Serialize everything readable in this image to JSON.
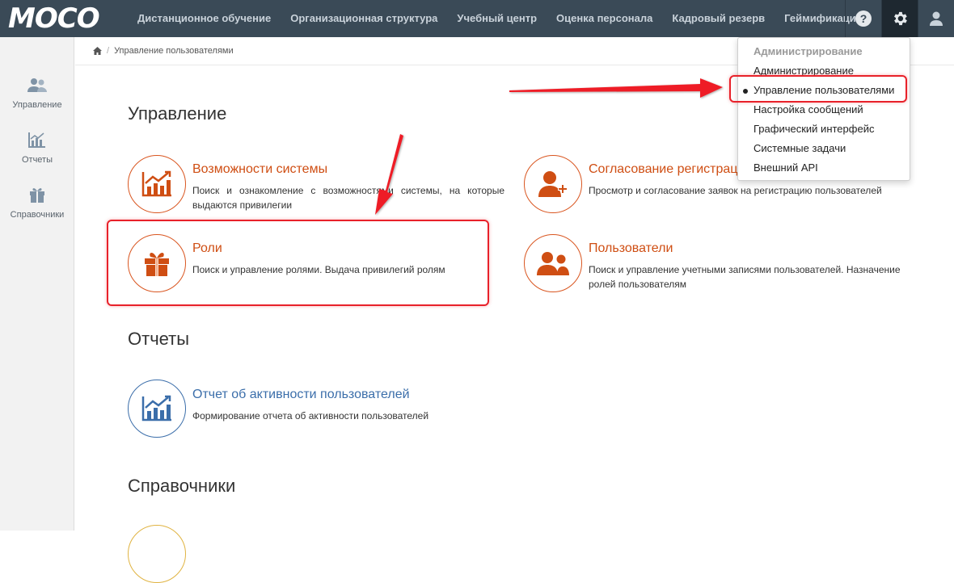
{
  "brand": {
    "logo_text": "MOCO"
  },
  "topnav": {
    "items": [
      "Дистанционное обучение",
      "Организационная структура",
      "Учебный центр",
      "Оценка персонала",
      "Кадровый резерв",
      "Геймификация"
    ],
    "icons": [
      "help-icon",
      "gear-icon",
      "user-icon"
    ],
    "help_glyph": "?"
  },
  "sidebar": {
    "items": [
      {
        "label": "Управление",
        "icon": "users-icon"
      },
      {
        "label": "Отчеты",
        "icon": "chart-icon"
      },
      {
        "label": "Справочники",
        "icon": "gift-icon"
      }
    ]
  },
  "breadcrumb": {
    "home_icon": "home-icon",
    "sep": "/",
    "current": "Управление пользователями"
  },
  "sections": {
    "management": {
      "title": "Управление",
      "cards": [
        {
          "title": "Возможности системы",
          "desc": "Поиск и ознакомление с возможностями системы, на которые выдаются привилегии",
          "icon": "chart-icon"
        },
        {
          "title": "Согласование регистраций",
          "desc": "Просмотр и согласование заявок на регистрацию пользователей",
          "icon": "user-add-icon"
        },
        {
          "title": "Роли",
          "desc": "Поиск и управление ролями. Выдача привилегий ролям",
          "icon": "gift-icon"
        },
        {
          "title": "Пользователи",
          "desc": "Поиск и управление учетными записями пользователей. Назначение ролей пользователям",
          "icon": "users-icon"
        }
      ]
    },
    "reports": {
      "title": "Отчеты",
      "cards": [
        {
          "title": "Отчет об активности пользователей",
          "desc": "Формирование отчета об активности пользователей",
          "icon": "chart-icon"
        }
      ]
    },
    "references": {
      "title": "Справочники"
    }
  },
  "dropdown": {
    "header": "Администрирование",
    "items": [
      "Администрирование",
      "Управление пользователями",
      "Настройка сообщений",
      "Графический интерфейс",
      "Системные задачи",
      "Внешний API"
    ],
    "current": "Управление пользователями"
  },
  "colors": {
    "navbar": "#3a4a57",
    "accent": "#cf4e13",
    "link_blue": "#3b6eaa",
    "highlight_red": "#e8212a"
  }
}
